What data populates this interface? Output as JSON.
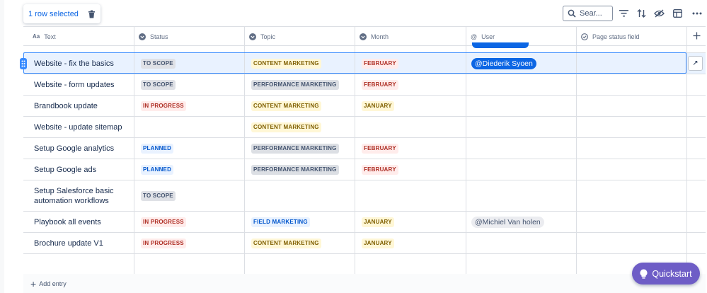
{
  "toolbar": {
    "selection_text": "1 row selected",
    "search_placeholder": "Sear..."
  },
  "columns": [
    {
      "label": "Text",
      "icon": "aa-text-icon"
    },
    {
      "label": "Status",
      "icon": "status-dropdown-icon"
    },
    {
      "label": "Topic",
      "icon": "topic-dropdown-icon"
    },
    {
      "label": "Month",
      "icon": "month-dropdown-icon"
    },
    {
      "label": "User",
      "icon": "at-icon"
    },
    {
      "label": "Page status field",
      "icon": "page-status-icon"
    }
  ],
  "rows": [
    {
      "text": "Website - fix the basics",
      "status": "TO SCOPE",
      "topic": "CONTENT MARKETING",
      "month": "FEBRUARY",
      "user": "@Diederik Syoen",
      "selected": true
    },
    {
      "text": "Website - form updates",
      "status": "TO SCOPE",
      "topic": "PERFORMANCE MARKETING",
      "month": "FEBRUARY",
      "user": ""
    },
    {
      "text": "Brandbook update",
      "status": "IN PROGRESS",
      "topic": "CONTENT MARKETING",
      "month": "JANUARY",
      "user": ""
    },
    {
      "text": "Website - update sitemap",
      "status": "",
      "topic": "CONTENT MARKETING",
      "month": "",
      "user": ""
    },
    {
      "text": "Setup Google analytics",
      "status": "PLANNED",
      "topic": "PERFORMANCE MARKETING",
      "month": "FEBRUARY",
      "user": ""
    },
    {
      "text": "Setup Google ads",
      "status": "PLANNED",
      "topic": "PERFORMANCE MARKETING",
      "month": "FEBRUARY",
      "user": ""
    },
    {
      "text_line1": "Setup Salesforce basic",
      "text_line2": "automation workflows",
      "status": "TO SCOPE",
      "topic": "",
      "month": "",
      "user": ""
    },
    {
      "text": "Playbook all events",
      "status": "IN PROGRESS",
      "topic": "FIELD MARKETING",
      "month": "JANUARY",
      "user": "@Michiel Van holen"
    },
    {
      "text": "Brochure update V1",
      "status": "IN PROGRESS",
      "topic": "CONTENT MARKETING",
      "month": "JANUARY",
      "user": ""
    }
  ],
  "footer": {
    "add_entry": "Add entry"
  },
  "quickstart": {
    "label": "Quickstart"
  },
  "colors": {
    "to_scope_bg": "#dfe1e6",
    "to_scope_fg": "#44546f",
    "in_progress_bg": "#ffeceb",
    "in_progress_fg": "#ae2e24",
    "planned_bg": "#e9f2ff",
    "planned_fg": "#0055cc",
    "content_bg": "#fff7d6",
    "content_fg": "#7f5f01",
    "performance_bg": "#dcdfe4",
    "performance_fg": "#44546f",
    "field_bg": "#e9f2ff",
    "field_fg": "#0055cc",
    "february_bg": "#ffeceb",
    "february_fg": "#ae2e24",
    "january_bg": "#fff7d6",
    "january_fg": "#7f5f01",
    "accent": "#388bff",
    "quickstart": "#6e5dc6"
  }
}
